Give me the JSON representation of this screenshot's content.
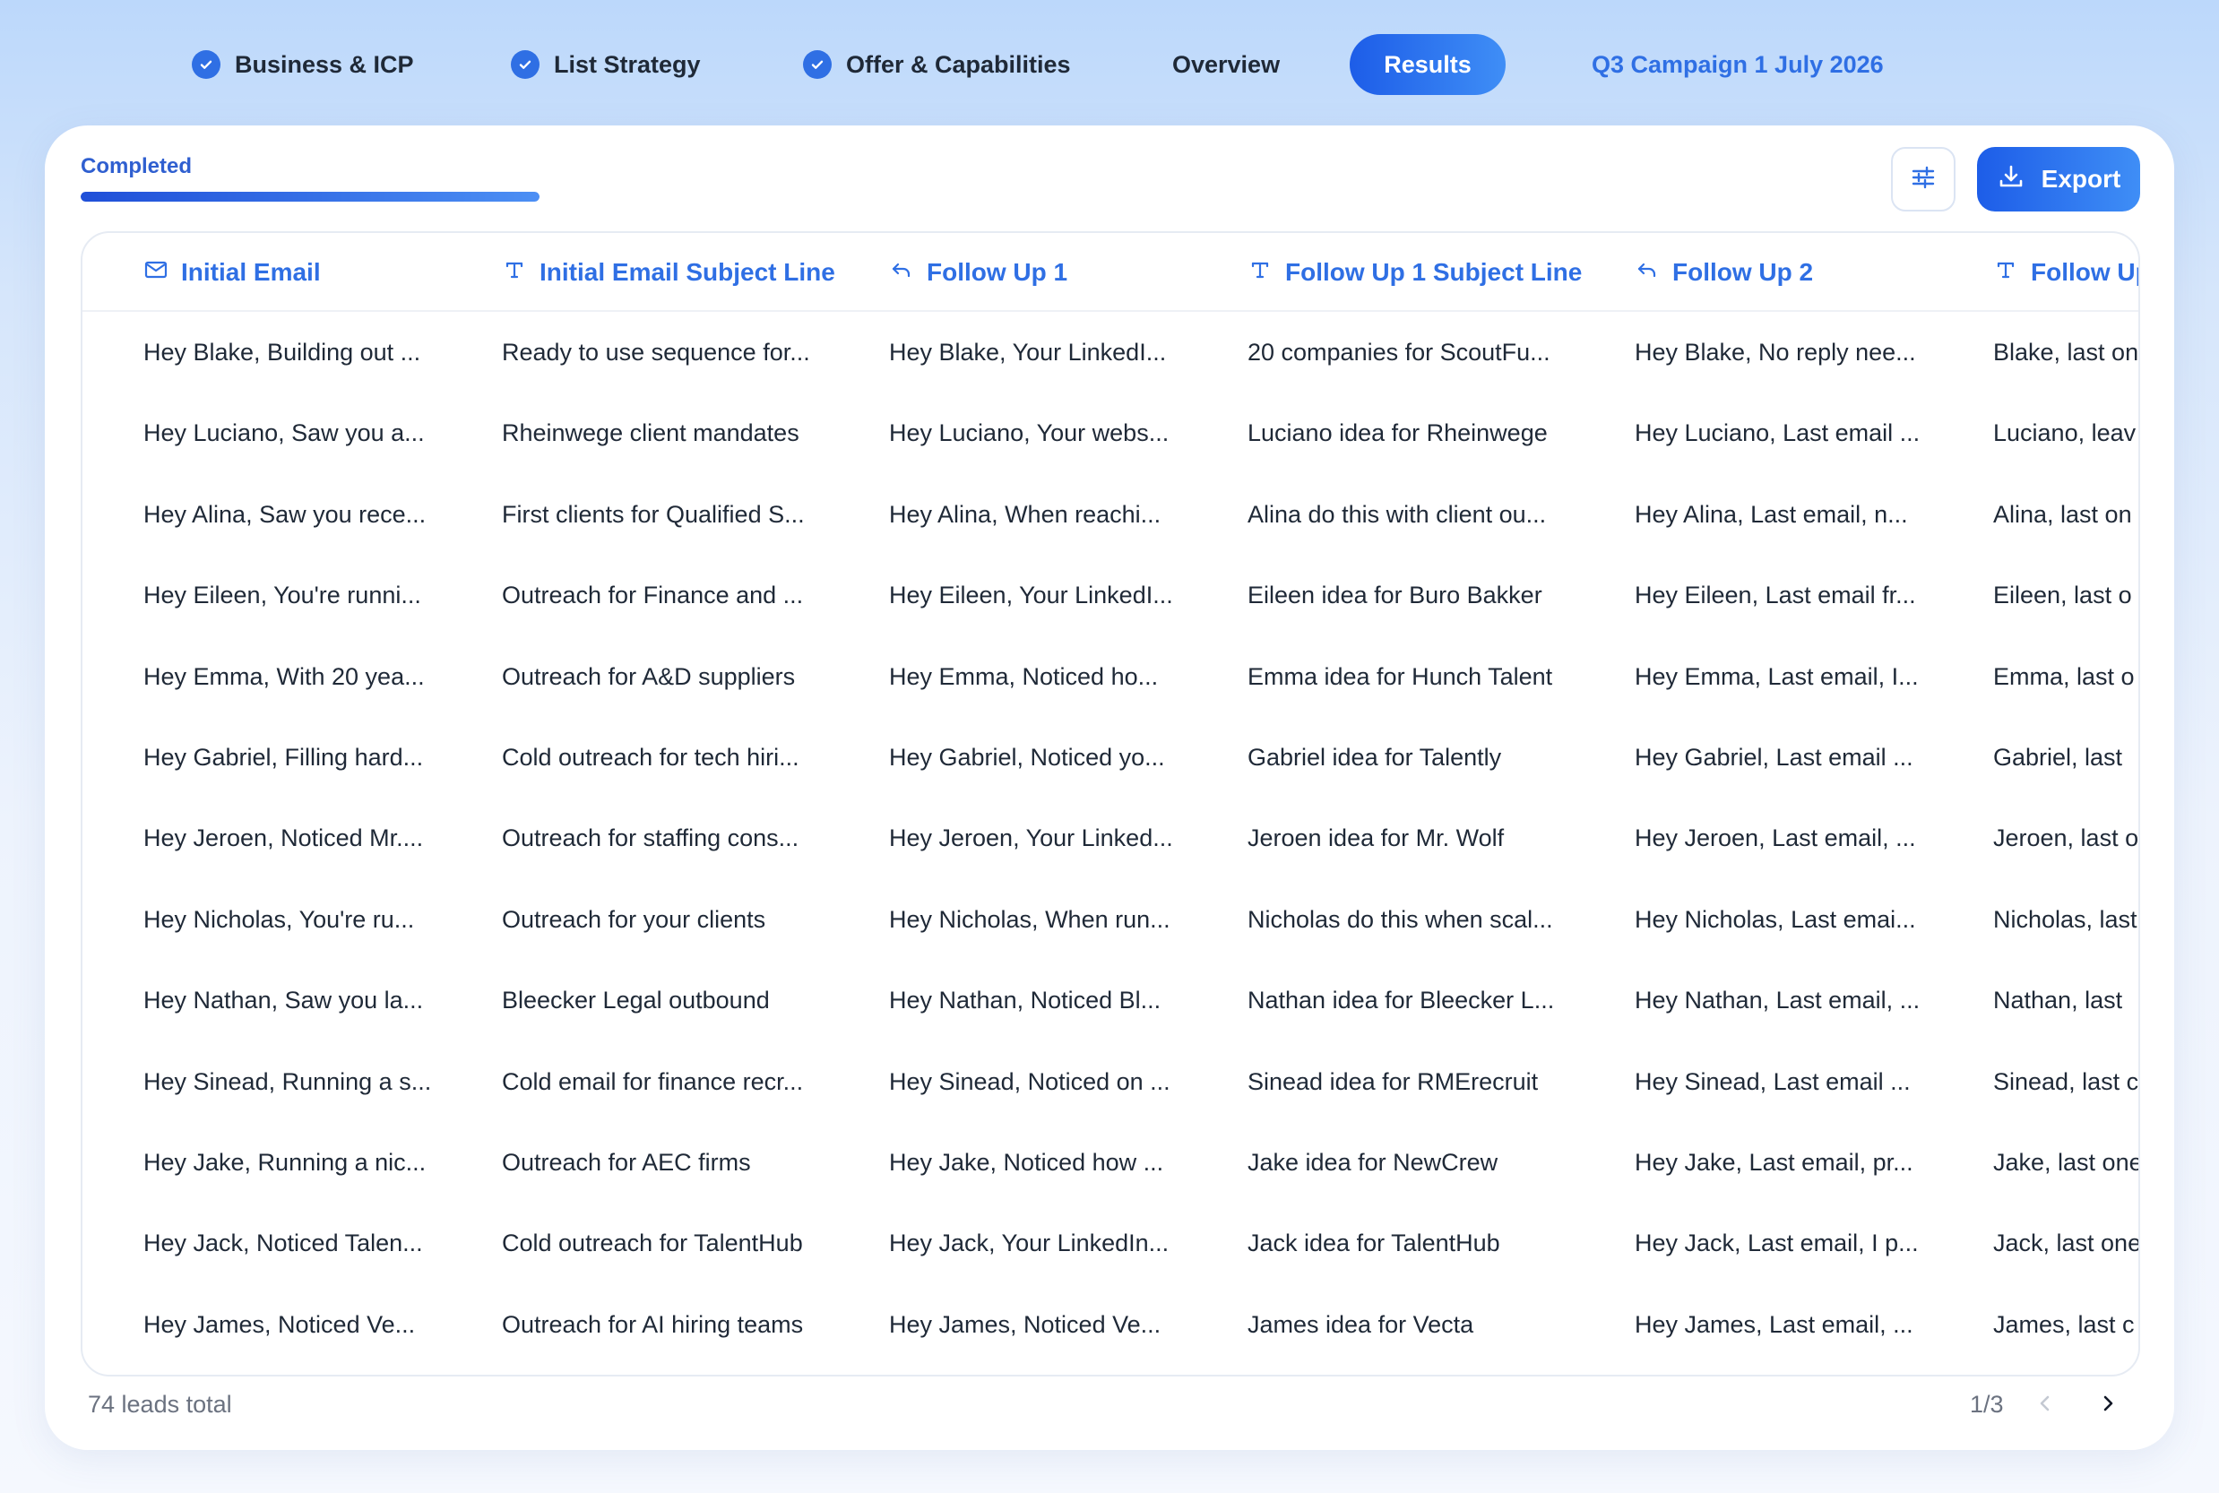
{
  "nav": {
    "steps": [
      {
        "label": "Business & ICP",
        "done": true
      },
      {
        "label": "List Strategy",
        "done": true
      },
      {
        "label": "Offer & Capabilities",
        "done": true
      },
      {
        "label": "Overview",
        "done": false
      },
      {
        "label": "Results",
        "active": true
      }
    ],
    "campaign": "Q3 Campaign 1 July 2026"
  },
  "status": {
    "label": "Completed",
    "progress": 1.0
  },
  "toolbar": {
    "filter_icon": "sliders-icon",
    "export_label": "Export",
    "export_icon": "download-icon"
  },
  "table": {
    "columns": [
      {
        "label": "Initial Email",
        "icon": "mail-icon"
      },
      {
        "label": "Initial Email Subject Line",
        "icon": "text-icon"
      },
      {
        "label": "Follow Up 1",
        "icon": "reply-icon"
      },
      {
        "label": "Follow Up 1 Subject Line",
        "icon": "text-icon"
      },
      {
        "label": "Follow Up 2",
        "icon": "reply-icon"
      },
      {
        "label": "Follow Up",
        "icon": "text-icon"
      }
    ],
    "rows": [
      [
        "Hey Blake, Building out ...",
        "Ready to use sequence for...",
        "Hey Blake, Your LinkedI...",
        "20 companies for ScoutFu...",
        "Hey Blake, No reply nee...",
        "Blake, last on"
      ],
      [
        "Hey Luciano, Saw you a...",
        "Rheinwege client mandates",
        "Hey Luciano, Your webs...",
        "Luciano idea for Rheinwege",
        "Hey Luciano, Last email ...",
        "Luciano, leav"
      ],
      [
        "Hey Alina, Saw you rece...",
        "First clients for Qualified S...",
        "Hey Alina, When reachi...",
        "Alina do this with client ou...",
        "Hey Alina, Last email, n...",
        "Alina, last on"
      ],
      [
        "Hey Eileen, You're runni...",
        "Outreach for Finance and ...",
        "Hey Eileen, Your LinkedI...",
        "Eileen idea for Buro Bakker",
        "Hey Eileen, Last email fr...",
        "Eileen, last o"
      ],
      [
        "Hey Emma, With 20 yea...",
        "Outreach for A&D suppliers",
        "Hey Emma, Noticed ho...",
        "Emma idea for Hunch Talent",
        "Hey Emma, Last email, I...",
        "Emma, last o"
      ],
      [
        "Hey Gabriel, Filling hard...",
        "Cold outreach for tech hiri...",
        "Hey Gabriel, Noticed yo...",
        "Gabriel idea for Talently",
        "Hey Gabriel, Last email ...",
        "Gabriel, last"
      ],
      [
        "Hey Jeroen, Noticed Mr....",
        "Outreach for staffing cons...",
        "Hey Jeroen, Your Linked...",
        "Jeroen idea for Mr. Wolf",
        "Hey Jeroen, Last email, ...",
        "Jeroen, last o"
      ],
      [
        "Hey Nicholas, You're ru...",
        "Outreach for your clients",
        "Hey Nicholas, When run...",
        "Nicholas do this when scal...",
        "Hey Nicholas, Last emai...",
        "Nicholas, last"
      ],
      [
        "Hey Nathan, Saw you la...",
        "Bleecker Legal outbound",
        "Hey Nathan, Noticed Bl...",
        "Nathan idea for Bleecker L...",
        "Hey Nathan, Last email, ...",
        "Nathan, last"
      ],
      [
        "Hey Sinead, Running a s...",
        "Cold email for finance recr...",
        "Hey Sinead, Noticed on ...",
        "Sinead idea for RMErecruit",
        "Hey Sinead, Last email ...",
        "Sinead, last c"
      ],
      [
        "Hey Jake, Running a nic...",
        "Outreach for AEC firms",
        "Hey Jake, Noticed how ...",
        "Jake idea for NewCrew",
        "Hey Jake, Last email, pr...",
        "Jake, last one"
      ],
      [
        "Hey Jack, Noticed Talen...",
        "Cold outreach for TalentHub",
        "Hey Jack, Your LinkedIn...",
        "Jack idea for TalentHub",
        "Hey Jack, Last email, I p...",
        "Jack, last one"
      ],
      [
        "Hey James, Noticed Ve...",
        "Outreach for AI hiring teams",
        "Hey James, Noticed Ve...",
        "James idea for Vecta",
        "Hey James, Last email, ...",
        "James, last c"
      ]
    ]
  },
  "footer": {
    "total": "74 leads total",
    "page": "1/3"
  },
  "colors": {
    "accent": "#2f6fe4",
    "accent_dark": "#1d5de8"
  }
}
